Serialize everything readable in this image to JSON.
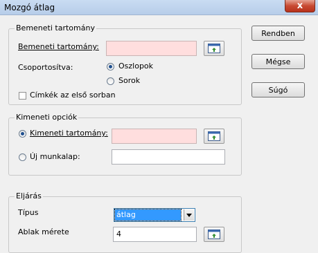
{
  "window": {
    "title": "Mozgó átlag",
    "close_glyph": "x"
  },
  "input_group": {
    "legend": "Bemeneti tartomány",
    "range_label": "Bemeneti tartomány:",
    "range_value": "",
    "grouped_label": "Csoportosítva:",
    "columns_label": "Oszlopok",
    "rows_label": "Sorok",
    "grouped_selected": "Oszlopok",
    "labels_checkbox_label": "Címkék az első sorban",
    "labels_checked": false
  },
  "output_group": {
    "legend": "Kimeneti opciók",
    "output_range_label": "Kimeneti tartomány:",
    "output_range_value": "",
    "new_sheet_label": "Új munkalap:",
    "new_sheet_value": "",
    "selected": "Kimeneti tartomány:"
  },
  "method_group": {
    "legend": "Eljárás",
    "type_label": "Típus",
    "type_value": "átlag",
    "window_size_label": "Ablak mérete",
    "window_size_value": "4"
  },
  "buttons": {
    "ok": "Rendben",
    "cancel": "Mégse",
    "help": "Súgó"
  },
  "icons": {
    "range_select": "range-select-icon",
    "close": "close-icon",
    "dropdown": "chevron-down-icon"
  }
}
